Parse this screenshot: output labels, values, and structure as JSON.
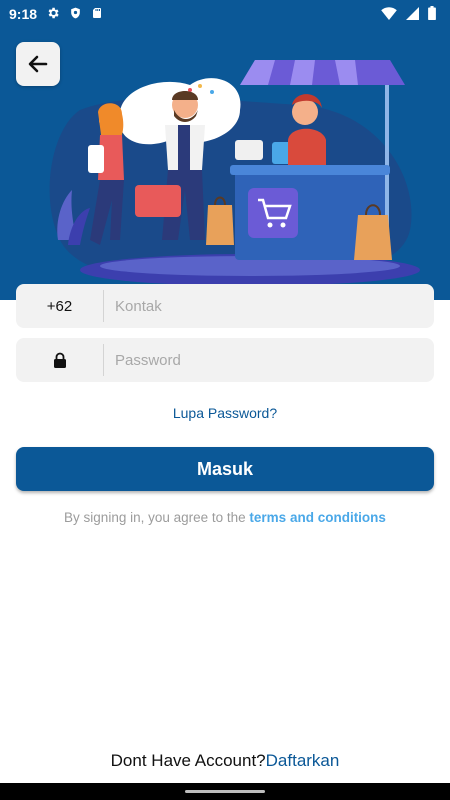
{
  "status_bar": {
    "time": "9:18",
    "icons_left": [
      "gear-icon",
      "shield-icon",
      "sd-card-icon"
    ],
    "icons_right": [
      "wifi-icon",
      "signal-icon",
      "battery-icon"
    ]
  },
  "back_button": {
    "icon": "arrow-left-icon"
  },
  "illustration": {
    "subject": "shopping-illustration"
  },
  "phone_field": {
    "prefix": "+62",
    "placeholder": "Kontak",
    "value": ""
  },
  "password_field": {
    "icon": "lock-icon",
    "placeholder": "Password",
    "value": ""
  },
  "forgot_password": "Lupa Password?",
  "login_button": "Masuk",
  "agreement": {
    "text": "By signing in, you agree to the ",
    "link": "terms and conditions"
  },
  "signup": {
    "text": "Dont Have Account?",
    "link": "Daftarkan"
  },
  "colors": {
    "primary": "#0b5897",
    "link_light": "#4aa8e8",
    "field_bg": "#f2f2f2",
    "placeholder": "#a8a8a8",
    "muted_text": "#9c9c9c"
  }
}
